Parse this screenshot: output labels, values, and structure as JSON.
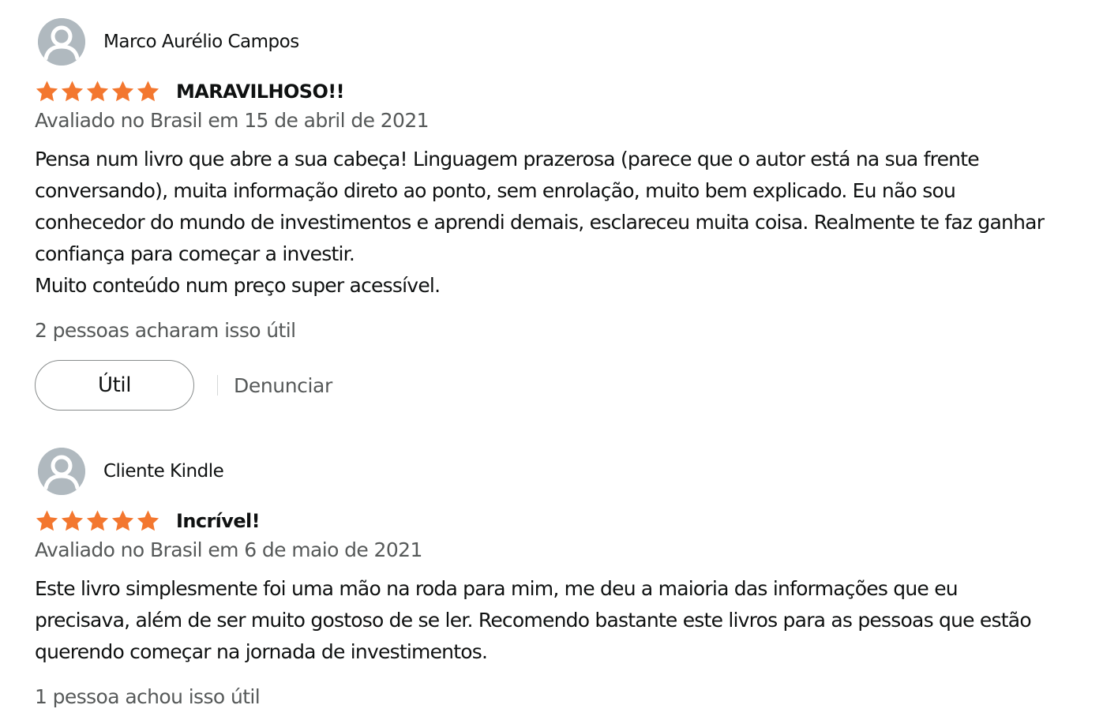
{
  "colors": {
    "star": "#f3772f",
    "avatar_bg": "#b0b9bf",
    "secondary_text": "#565959"
  },
  "reviews": [
    {
      "reviewer": "Marco Aurélio Campos",
      "rating": 5,
      "rating_max": 5,
      "title": "MARAVILHOSO!!",
      "date": "Avaliado no Brasil em 15 de abril de 2021",
      "body_lines": [
        "Pensa num livro que abre a sua cabeça! Linguagem prazerosa (parece que o autor está na sua frente",
        "conversando), muita informação direto ao ponto, sem enrolação, muito bem explicado. Eu não sou",
        "conhecedor do mundo de investimentos e aprendi demais, esclareceu muita coisa. Realmente te faz ganhar",
        "confiança para começar a investir.",
        "Muito conteúdo num preço super acessível."
      ],
      "helpful_count_text": "2 pessoas acharam isso útil",
      "helpful_button": "Útil",
      "report_link": "Denunciar"
    },
    {
      "reviewer": "Cliente Kindle",
      "rating": 5,
      "rating_max": 5,
      "title": "Incrível!",
      "date": "Avaliado no Brasil em 6 de maio de 2021",
      "body_lines": [
        "Este livro simplesmente foi uma mão na roda para mim, me deu a maioria das informações que eu",
        "precisava, além de ser muito gostoso de se ler. Recomendo bastante este livros para as pessoas que estão",
        "querendo começar na jornada de investimentos."
      ],
      "helpful_count_text": "1 pessoa achou isso útil"
    }
  ]
}
